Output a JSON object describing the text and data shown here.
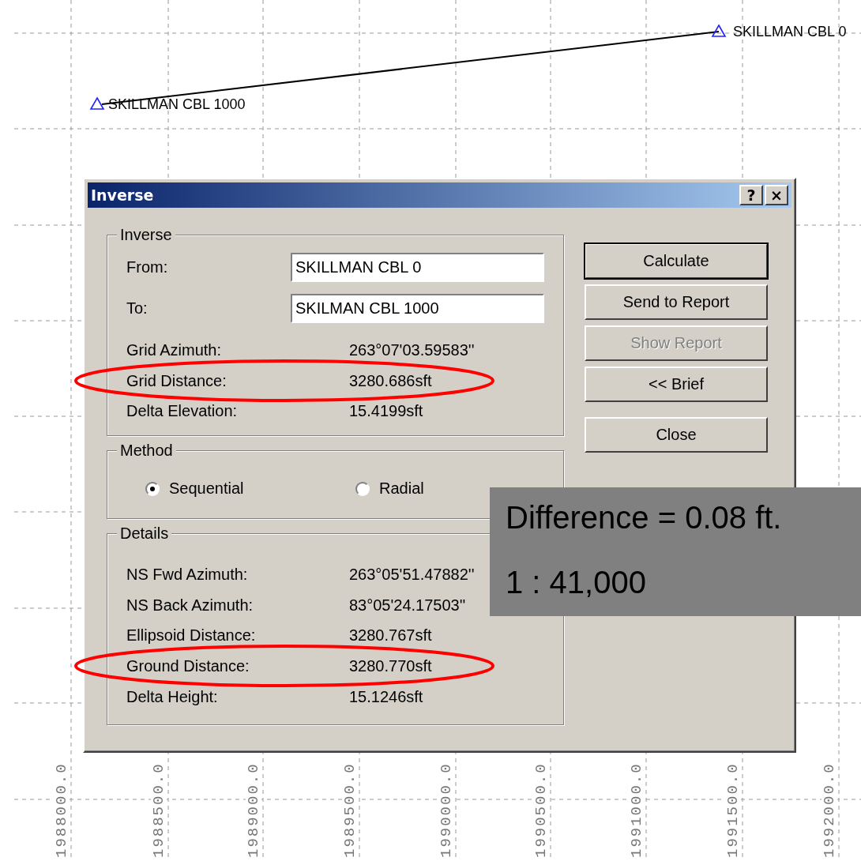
{
  "plot": {
    "points": [
      {
        "label": "SKILLMAN CBL 0"
      },
      {
        "label": "SKILLMAN CBL 1000"
      }
    ],
    "x_axis_labels": [
      "1988000.0",
      "1988500.0",
      "1989000.0",
      "1989500.0",
      "1990000.0",
      "1990500.0",
      "1991000.0",
      "1991500.0",
      "1992000.0"
    ]
  },
  "dialog": {
    "title": "Inverse",
    "title_buttons": [
      "?",
      "×"
    ],
    "inverse_group": {
      "legend": "Inverse",
      "fields": [
        {
          "label": "From:",
          "value": "SKILLMAN CBL 0"
        },
        {
          "label": "To:",
          "value": "SKILMAN CBL 1000"
        }
      ],
      "rows": [
        {
          "label": "Grid Azimuth:",
          "value": "263°07'03.59583''",
          "circled": false
        },
        {
          "label": "Grid Distance:",
          "value": "3280.686sft",
          "circled": true
        },
        {
          "label": "Delta Elevation:",
          "value": "15.4199sft",
          "circled": false
        }
      ]
    },
    "method_group": {
      "legend": "Method",
      "options": [
        {
          "label": "Sequential",
          "selected": true
        },
        {
          "label": "Radial",
          "selected": false
        }
      ]
    },
    "details_group": {
      "legend": "Details",
      "rows": [
        {
          "label": "NS Fwd Azimuth:",
          "value": "263°05'51.47882''",
          "circled": false
        },
        {
          "label": "NS Back Azimuth:",
          "value": "83°05'24.17503''",
          "circled": false
        },
        {
          "label": "Ellipsoid Distance:",
          "value": "3280.767sft",
          "circled": false
        },
        {
          "label": "Ground Distance:",
          "value": "3280.770sft",
          "circled": true
        },
        {
          "label": "Delta Height:",
          "value": "15.1246sft",
          "circled": false
        }
      ]
    },
    "buttons": [
      {
        "label": "Calculate",
        "default": true,
        "disabled": false
      },
      {
        "label": "Send to Report",
        "default": false,
        "disabled": false
      },
      {
        "label": "Show Report",
        "default": false,
        "disabled": true
      },
      {
        "label": "<< Brief",
        "default": false,
        "disabled": false
      },
      {
        "label": "Close",
        "default": false,
        "disabled": false
      }
    ]
  },
  "annotation": {
    "lines": [
      "Difference = 0.08 ft.",
      "1 : 41,000"
    ]
  }
}
